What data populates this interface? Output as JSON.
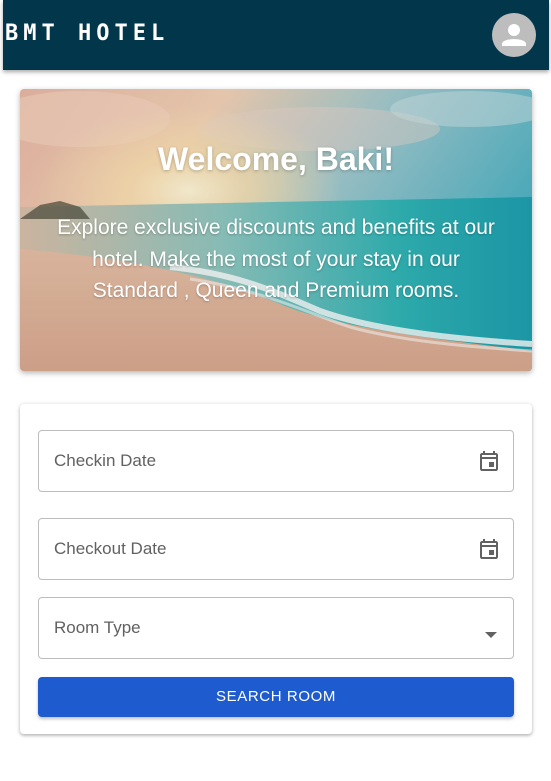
{
  "appbar": {
    "brand": "BMT HOTEL",
    "avatar_icon": "person-icon",
    "color": "#02364a"
  },
  "hero": {
    "title": "Welcome, Baki!",
    "text": "Explore exclusive discounts and benefits at our hotel. Make the most of your stay in our Standard , Queen and Premium rooms.",
    "image": "beach-sunset-image"
  },
  "search_form": {
    "checkin_label": "Checkin Date",
    "checkin_icon": "calendar-icon",
    "checkout_label": "Checkout Date",
    "checkout_icon": "calendar-icon",
    "room_type_label": "Room Type",
    "room_type_icon": "dropdown-arrow-icon",
    "search_button": "SEARCH ROOM",
    "button_color": "#1e5bcf"
  }
}
